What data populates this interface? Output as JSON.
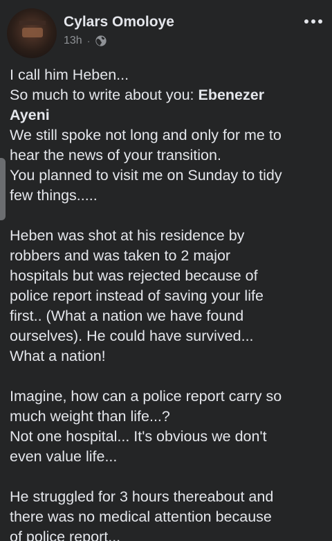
{
  "post": {
    "author": "Cylars Omoloye",
    "time": "13h",
    "separator": "·",
    "privacy_icon": "globe-icon",
    "more_icon": "more-options-icon",
    "paragraphs": [
      {
        "lines": [
          "I call him Heben...",
          "So much to write about you: ",
          "Ayeni",
          "We still spoke not long and only for me to",
          "hear the news of your transition.",
          "You planned to visit me on Sunday to tidy",
          "few things....."
        ],
        "bold_name_part1": "Ebenezer"
      },
      {
        "lines": [
          "Heben was shot at his residence by",
          "robbers and was taken to 2 major",
          "hospitals but was rejected because of",
          "police report instead of saving your life",
          "first.. (What a nation we have found",
          "ourselves). He could have survived...",
          "What a nation!"
        ]
      },
      {
        "lines": [
          "Imagine, how can a police report carry so",
          "much weight than life...?",
          "Not one hospital... It's obvious we don't",
          "even value life..."
        ]
      },
      {
        "lines": [
          "He struggled for 3 hours thereabout and",
          "there was no medical attention because",
          "of police report..."
        ]
      }
    ]
  },
  "colors": {
    "background": "#242526",
    "text": "#e4e6eb",
    "secondary_text": "#8f9296"
  }
}
